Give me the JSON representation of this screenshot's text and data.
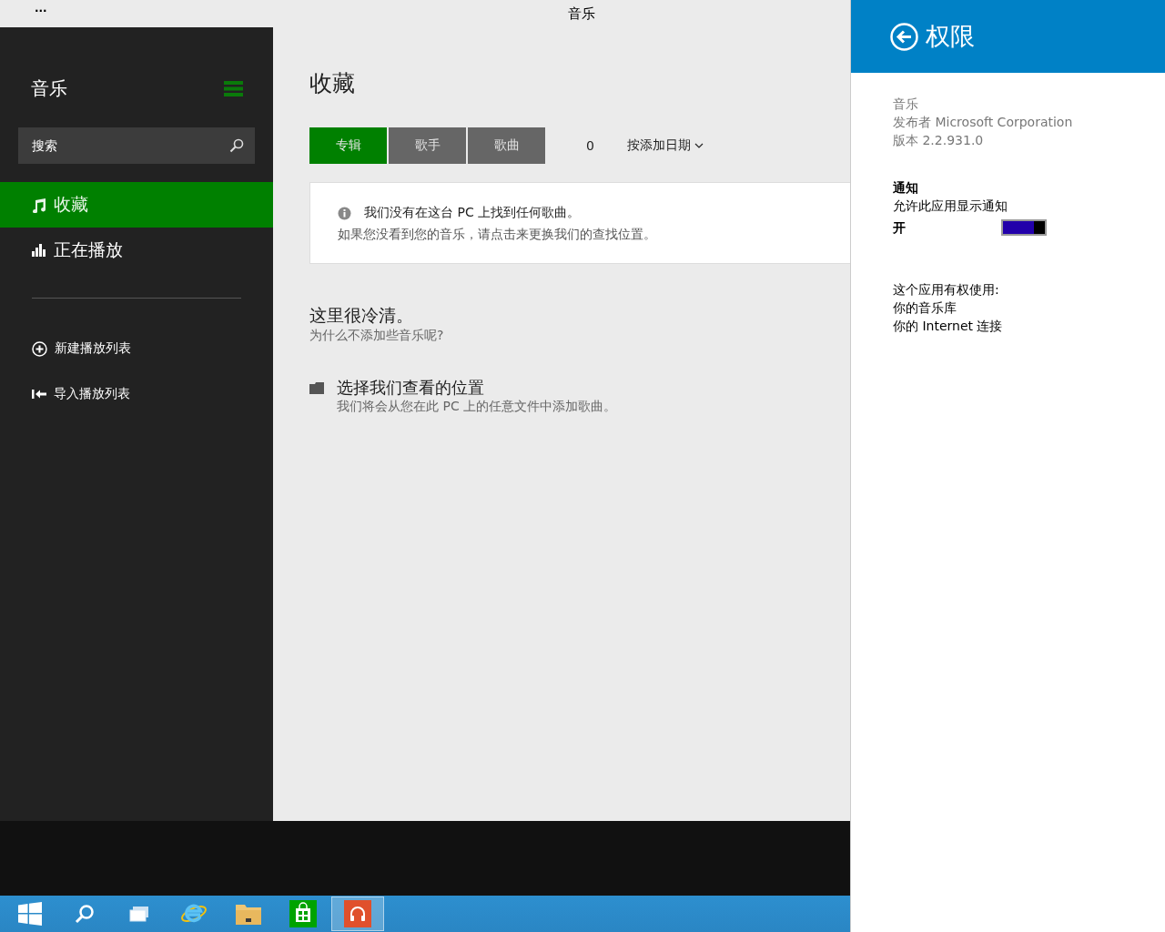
{
  "window": {
    "title": "音乐",
    "menu": "..."
  },
  "sidebar": {
    "title": "音乐",
    "search": {
      "placeholder": "搜索"
    },
    "nav": [
      {
        "label": "收藏",
        "kind": "music",
        "selected": true
      },
      {
        "label": "正在播放",
        "kind": "bars",
        "selected": false
      }
    ],
    "actions": [
      {
        "label": "新建播放列表",
        "kind": "add"
      },
      {
        "label": "导入播放列表",
        "kind": "import"
      }
    ]
  },
  "main": {
    "heading": "收藏",
    "tabs": [
      {
        "label": "专辑",
        "selected": true
      },
      {
        "label": "歌手",
        "selected": false
      },
      {
        "label": "歌曲",
        "selected": false
      }
    ],
    "count": "0",
    "sort": "按添加日期",
    "notice": {
      "title": "我们没有在这台 PC 上找到任何歌曲。",
      "text": "如果您没看到您的音乐，请点击来更换我们的查找位置。"
    },
    "empty": {
      "title": "这里很冷清。",
      "subtitle": "为什么不添加些音乐呢?"
    },
    "location": {
      "title": "选择我们查看的位置",
      "subtitle": "我们将会从您在此 PC 上的任意文件中添加歌曲。"
    }
  },
  "panel": {
    "title": "权限",
    "app_info": [
      "音乐",
      "发布者 Microsoft Corporation",
      "版本 2.2.931.0"
    ],
    "notifications": {
      "heading": "通知",
      "description": "允许此应用显示通知",
      "toggle": {
        "label": "开",
        "on": true
      }
    },
    "permissions": {
      "heading": "这个应用有权使用:",
      "items": [
        "你的音乐库",
        "你的 Internet 连接"
      ]
    }
  },
  "taskbar": {
    "items": [
      {
        "kind": "start",
        "selected": false
      },
      {
        "kind": "search",
        "selected": false
      },
      {
        "kind": "windows",
        "selected": false
      },
      {
        "kind": "browser",
        "selected": false
      },
      {
        "kind": "folder",
        "selected": false
      },
      {
        "kind": "store",
        "selected": false
      },
      {
        "kind": "music",
        "selected": true
      }
    ]
  }
}
